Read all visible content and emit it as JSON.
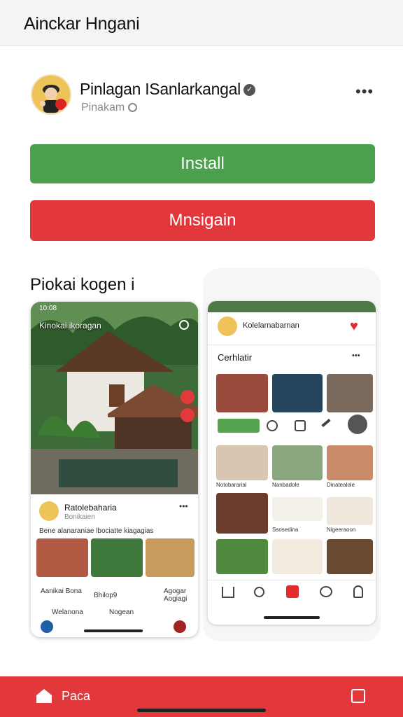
{
  "topbar": {
    "title": "Ainckar Hngani"
  },
  "profile": {
    "name": "Pinlagan ISanlarkangal",
    "subtitle": "Pinakam"
  },
  "buttons": {
    "install": "Install",
    "message": "Mnsigain"
  },
  "section": {
    "title": "Piokai kogen i"
  },
  "phone_left": {
    "status_time": "10:08",
    "hero_title": "Kinokai ikoragan",
    "post_author": "Ratolebaharia",
    "post_meta": "Bonikaien",
    "post_text": "Bene alanaraniae lbociatte kiagagias",
    "action1": "Aanikai Bona",
    "action2": "Bhilop9",
    "action3": "Agogar Aogiagi",
    "footer_left": "Welanona",
    "footer_mid": "Nogean"
  },
  "phone_right": {
    "header_name": "Kolelarnabarnan",
    "section_label": "Cerhlatir",
    "tag_label": "",
    "grid_captions": [
      "Notobararial",
      "Nanbadole",
      "Dinatealole",
      "Ssosedina",
      "Nigeeraoon",
      ""
    ]
  },
  "bottom": {
    "label": "Paca"
  },
  "colors": {
    "green": "#4aa04c",
    "red": "#e2383b"
  },
  "icons": [
    "verified-badge-icon",
    "globe-icon",
    "more-icon",
    "heart-icon",
    "home-icon",
    "search-icon",
    "add-icon",
    "chat-icon",
    "profile-icon",
    "store-icon"
  ]
}
